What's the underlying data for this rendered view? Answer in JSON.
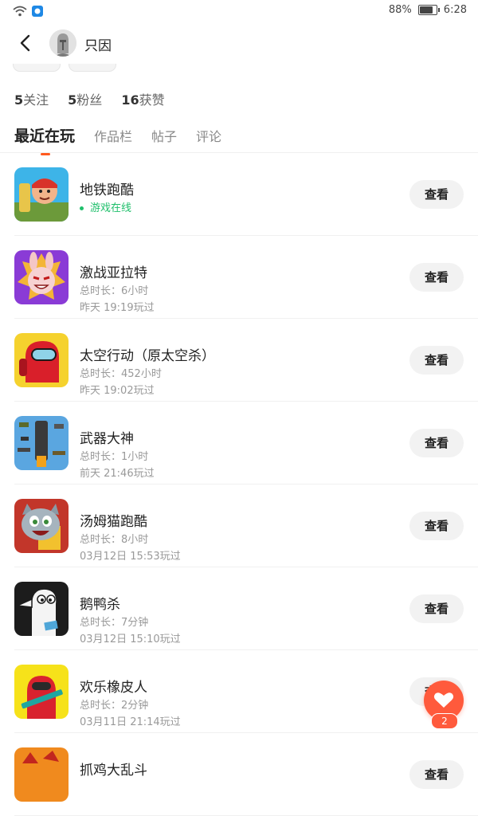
{
  "status_bar": {
    "battery": "88%",
    "battery_level": 0.88,
    "time": "6:28"
  },
  "header": {
    "user_name": "只因"
  },
  "stats": [
    {
      "num": "5",
      "label": "关注"
    },
    {
      "num": "5",
      "label": "粉丝"
    },
    {
      "num": "16",
      "label": "获赞"
    }
  ],
  "tabs": [
    "最近在玩",
    "作品栏",
    "帖子",
    "评论"
  ],
  "view_label": "查看",
  "games": [
    {
      "name": "地铁跑酷",
      "line1": "游戏在线",
      "line2": "",
      "online": true
    },
    {
      "name": "激战亚拉特",
      "line1": "总时长：6小时",
      "line2": "昨天 19:19玩过"
    },
    {
      "name": "太空行动（原太空杀）",
      "line1": "总时长：452小时",
      "line2": "昨天 19:02玩过"
    },
    {
      "name": "武器大神",
      "line1": "总时长：1小时",
      "line2": "前天 21:46玩过"
    },
    {
      "name": "汤姆猫跑酷",
      "line1": "总时长：8小时",
      "line2": "03月12日 15:53玩过"
    },
    {
      "name": "鹅鸭杀",
      "line1": "总时长：7分钟",
      "line2": "03月12日 15:10玩过"
    },
    {
      "name": "欢乐橡皮人",
      "line1": "总时长：2分钟",
      "line2": "03月11日 21:14玩过"
    },
    {
      "name": "抓鸡大乱斗",
      "line1": "",
      "line2": ""
    }
  ],
  "fab": {
    "badge": "2"
  },
  "colors": {
    "accent": "#ff5a1f",
    "online": "#1fbf6b",
    "fab": "#ff5a3c"
  }
}
